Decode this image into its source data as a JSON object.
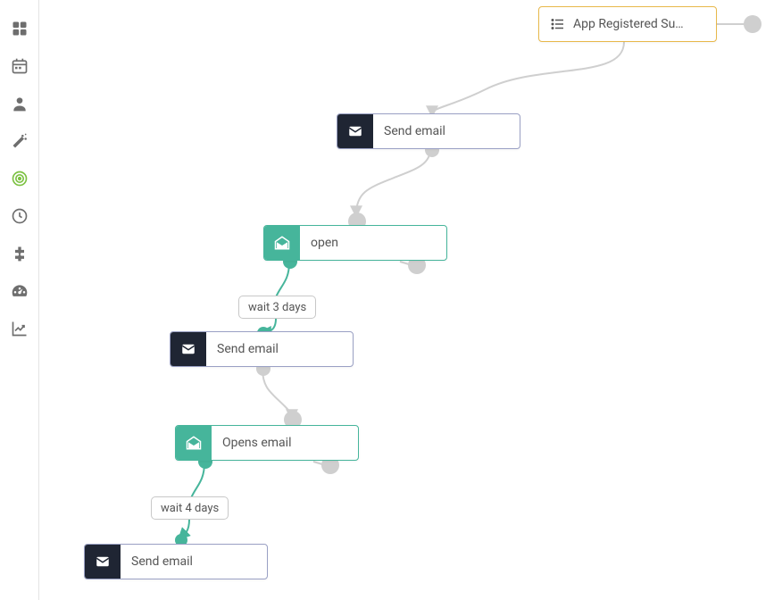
{
  "sidebar": {
    "items": [
      {
        "name": "dashboard-icon"
      },
      {
        "name": "calendar-icon"
      },
      {
        "name": "user-icon"
      },
      {
        "name": "magic-wand-icon"
      },
      {
        "name": "target-icon",
        "active": true
      },
      {
        "name": "clock-icon"
      },
      {
        "name": "plugin-icon"
      },
      {
        "name": "gauge-icon"
      },
      {
        "name": "chart-icon"
      }
    ]
  },
  "flow": {
    "trigger": {
      "label": "App Registered Su…"
    },
    "nodes": [
      {
        "type": "send",
        "label": "Send email"
      },
      {
        "type": "cond",
        "label": "open"
      },
      {
        "type": "wait",
        "label": "wait 3 days"
      },
      {
        "type": "send",
        "label": "Send email"
      },
      {
        "type": "cond",
        "label": "Opens email"
      },
      {
        "type": "wait",
        "label": "wait 4 days"
      },
      {
        "type": "send",
        "label": "Send email"
      }
    ]
  },
  "colors": {
    "accent_teal": "#46b59b",
    "accent_green": "#7cc142",
    "dark": "#1f2533",
    "trigger_border": "#e8b84a",
    "grey_dot": "#cfcfcf"
  }
}
